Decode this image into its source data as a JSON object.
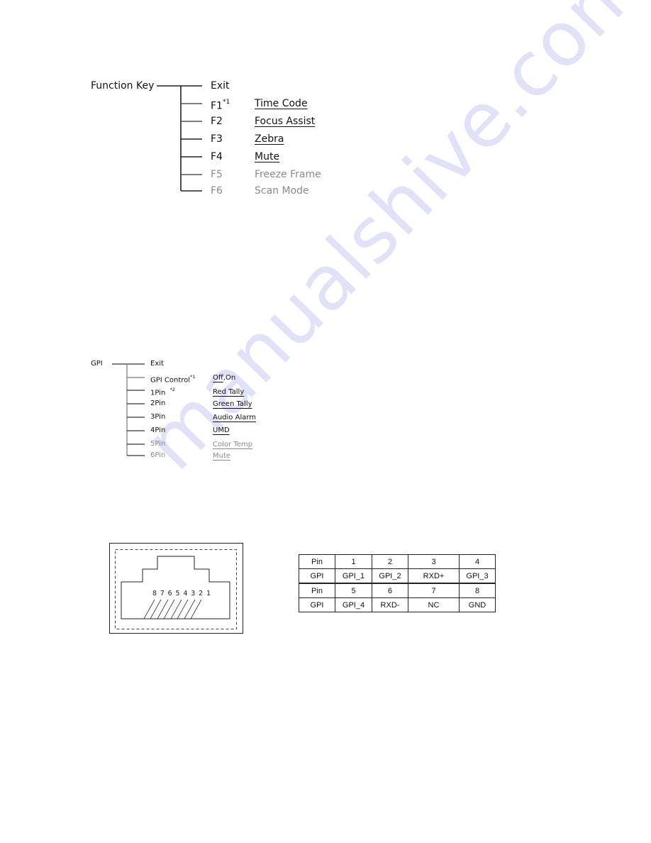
{
  "function_key_tree": {
    "root": "Function Key",
    "items": [
      {
        "key": "Exit",
        "sup": "",
        "value": "",
        "grey": false
      },
      {
        "key": "F1",
        "sup": "*1",
        "value": "Time Code",
        "grey": false
      },
      {
        "key": "F2",
        "sup": "",
        "value": "Focus Assist",
        "grey": false
      },
      {
        "key": "F3",
        "sup": "",
        "value": "Zebra",
        "grey": false
      },
      {
        "key": "F4",
        "sup": "",
        "value": "Mute",
        "grey": false
      },
      {
        "key": "F5",
        "sup": "",
        "value": "Freeze Frame",
        "grey": true
      },
      {
        "key": "F6",
        "sup": "",
        "value": "Scan Mode",
        "grey": true
      }
    ]
  },
  "gpi_tree": {
    "root": "GPI",
    "items": [
      {
        "key": "Exit",
        "sup": "",
        "value": "",
        "grey": false
      },
      {
        "key": "GPI Control",
        "sup": "*1",
        "value_underlined": "Off",
        "value_rest": ",On",
        "grey": false
      },
      {
        "key": "1Pin",
        "sup": "*2",
        "value": "Red Tally",
        "grey": false
      },
      {
        "key": "2Pin",
        "sup": "",
        "value": "Green Tally",
        "grey": false
      },
      {
        "key": "3Pin",
        "sup": "",
        "value": "Audio Alarm",
        "grey": false
      },
      {
        "key": "4Pin",
        "sup": "",
        "value": "UMD",
        "grey": false
      },
      {
        "key": "5Pin",
        "sup": "",
        "value": "Color Temp",
        "grey": true
      },
      {
        "key": "6Pin",
        "sup": "",
        "value": "Mute",
        "grey": true
      }
    ]
  },
  "connector": {
    "pin_numbers": "8 7 6 5 4 3 2 1"
  },
  "pin_table": {
    "rows": [
      [
        "Pin",
        "1",
        "2",
        "3",
        "4"
      ],
      [
        "GPI",
        "GPI_1",
        "GPI_2",
        "RXD+",
        "GPI_3"
      ],
      [
        "Pin",
        "5",
        "6",
        "7",
        "8"
      ],
      [
        "GPI",
        "GPI_4",
        "RXD-",
        "NC",
        "GND"
      ]
    ]
  },
  "watermark": "manualshive.com"
}
